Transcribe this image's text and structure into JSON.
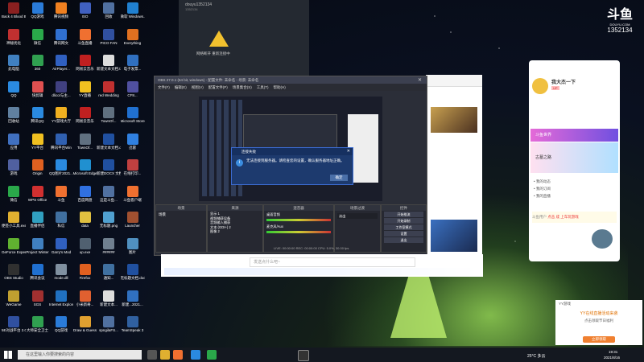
{
  "desktop_icons": [
    {
      "label": "Back 4 Blood Beta",
      "color": "#8a2020"
    },
    {
      "label": "QQ游戏",
      "color": "#2a7bd8"
    },
    {
      "label": "腾讯视频",
      "color": "#f08020"
    },
    {
      "label": "ISO",
      "color": "#4060c0"
    },
    {
      "label": "回收",
      "color": "#5070a0"
    },
    {
      "label": "微软 Windows...",
      "color": "#2080d0"
    },
    {
      "label": "神秘优化",
      "color": "#c03030"
    },
    {
      "label": "微信",
      "color": "#2aa84a"
    },
    {
      "label": "腾讯网文",
      "color": "#3070d0"
    },
    {
      "label": "斗鱼直播",
      "color": "#f07030"
    },
    {
      "label": "PICO FAN",
      "color": "#3050a0"
    },
    {
      "label": "Everything",
      "color": "#e07020"
    },
    {
      "label": "此电脑",
      "color": "#4080c0"
    },
    {
      "label": "360",
      "color": "#30a050"
    },
    {
      "label": "AirPlayer...",
      "color": "#3060c0"
    },
    {
      "label": "网易云音乐",
      "color": "#c02020"
    },
    {
      "label": "新建文本文档.txt",
      "color": "#dddddd"
    },
    {
      "label": "电子发票...",
      "color": "#3070c0"
    },
    {
      "label": "QQ",
      "color": "#2a8ae0"
    },
    {
      "label": "快剪辑",
      "color": "#e05050"
    },
    {
      "label": "dlico/与主...",
      "color": "#404080"
    },
    {
      "label": "YY直播",
      "color": "#f0c020"
    },
    {
      "label": "red Wedding",
      "color": "#c03030"
    },
    {
      "label": "CF8...",
      "color": "#5050a0"
    },
    {
      "label": "回收站",
      "color": "#6080a0"
    },
    {
      "label": "腾讯QQ",
      "color": "#2a8ae0"
    },
    {
      "label": "YY游戏大厅",
      "color": "#f0b020"
    },
    {
      "label": "网易云音乐",
      "color": "#c02020"
    },
    {
      "label": "TownOf...",
      "color": "#607080"
    },
    {
      "label": "Microsoft Store",
      "color": "#2070d0"
    },
    {
      "label": "应用",
      "color": "#4070c0"
    },
    {
      "label": "YY平台",
      "color": "#f0c020"
    },
    {
      "label": "腾讯平台Win",
      "color": "#3060b0"
    },
    {
      "label": "TownOf...",
      "color": "#607080"
    },
    {
      "label": "新建文本文档.docx",
      "color": "#2050a0"
    },
    {
      "label": "迅雷",
      "color": "#3080e0"
    },
    {
      "label": "游戏",
      "color": "#5060a0"
    },
    {
      "label": "Origin",
      "color": "#e06020"
    },
    {
      "label": "QQ图片2021...",
      "color": "#2a8ae0"
    },
    {
      "label": "Microsoft Edge",
      "color": "#2090d0"
    },
    {
      "label": "新建DOCX 文档.docx",
      "color": "#2050a0"
    },
    {
      "label": "在线打印...",
      "color": "#c04040"
    },
    {
      "label": "微信",
      "color": "#2aa84a"
    },
    {
      "label": "WPS Office",
      "color": "#d03030"
    },
    {
      "label": "斗鱼",
      "color": "#f07030"
    },
    {
      "label": "百度网盘",
      "color": "#3070e0"
    },
    {
      "label": "这是斗鱼...",
      "color": "#5070a0"
    },
    {
      "label": "斗鱼客户端",
      "color": "#f07030"
    },
    {
      "label": "便签小工具.exe",
      "color": "#e0b030"
    },
    {
      "label": "直播伴侣",
      "color": "#30a0c0"
    },
    {
      "label": "私信",
      "color": "#4070a0"
    },
    {
      "label": "data",
      "color": "#e0c040"
    },
    {
      "label": "无标题.png",
      "color": "#50a0d0"
    },
    {
      "label": "Launcher",
      "color": "#a05030"
    },
    {
      "label": "GeForce Experience",
      "color": "#60b030"
    },
    {
      "label": "Project Winter",
      "color": "#4080c0"
    },
    {
      "label": "Garry's Mod",
      "color": "#3060c0"
    },
    {
      "label": "up.exe",
      "color": "#506070"
    },
    {
      "label": "######",
      "color": "#708090"
    },
    {
      "label": "图片",
      "color": "#5090c0"
    },
    {
      "label": "OBS Studio",
      "color": "#303030"
    },
    {
      "label": "腾讯会议",
      "color": "#2070d0"
    },
    {
      "label": "mode.dll",
      "color": "#8090a0"
    },
    {
      "label": "Firefox",
      "color": "#e06020"
    },
    {
      "label": "通知...",
      "color": "#4070a0"
    },
    {
      "label": "无标题文档.docx",
      "color": "#2050a0"
    },
    {
      "label": "WeGame",
      "color": "#c0a030"
    },
    {
      "label": "SGS",
      "color": "#a03030"
    },
    {
      "label": "Internet Explorer",
      "color": "#2070c0"
    },
    {
      "label": "小米新奇...",
      "color": "#e06030"
    },
    {
      "label": "新建文本...",
      "color": "#dddddd"
    },
    {
      "label": "新建...2021...",
      "color": "#3070c0"
    },
    {
      "label": "5E对战平台 2.0",
      "color": "#3050a0"
    },
    {
      "label": "大师安全卫士",
      "color": "#30a050"
    },
    {
      "label": "QQ游戏",
      "color": "#2a7bd8"
    },
    {
      "label": "Draw & Guess",
      "color": "#e0a030"
    },
    {
      "label": "spngilaFS...",
      "color": "#5070a0"
    },
    {
      "label": "TeamSpeak 3",
      "color": "#3060a0"
    }
  ],
  "top_dialog": {
    "title": "douyu1352134",
    "subtitle": "1352134",
    "warning": "网络断开 重新连接中"
  },
  "obs": {
    "title": "OBS 27.0.1 (64 bit, windows) - 配置文件: 未命名 - 场景: 未命名",
    "menu": [
      "文件(F)",
      "编辑(E)",
      "视图(V)",
      "配置文件(P)",
      "场景集合(S)",
      "工具(T)",
      "帮助(H)"
    ],
    "dock_labels": [
      "场景",
      "来源",
      "混音器",
      "场景过渡",
      "控件"
    ],
    "scene_item": "场景",
    "sources": [
      "显示 1",
      "视频捕获设备",
      "音频输入捕获",
      "文本 (GDI+) 2",
      "图像 2"
    ],
    "mixer": [
      "桌面音频",
      "麦克风/Aux"
    ],
    "transition": "淡出",
    "controls": [
      "开始推流",
      "开始录制",
      "工作室模式",
      "设置",
      "退出"
    ],
    "status": "LIVE: 00:00:00   REC: 00:00:00   CPU: 5.0%, 30.00 fps"
  },
  "error_dialog": {
    "title": "连接失败",
    "message": "无法连接到服务器。请检查您的设置，确认服务器地址正确。",
    "ok": "确定"
  },
  "chatbar": {
    "placeholder": "发送点什么吧~",
    "labels": [
      "原神",
      "弹幕",
      "设置"
    ]
  },
  "right_panel": {
    "username": "我大杰一下",
    "level": "UP",
    "menu_items": [
      "我的动态",
      "我的订阅",
      "我的直播"
    ],
    "banner1": "斗鱼世界",
    "banner2": "古墓之路",
    "chat_user": "斗鱼用户",
    "chat_msg": "点击 成 上车玩游戏"
  },
  "logo": {
    "text": "斗鱼",
    "sub": "DOUYU.COM",
    "room": "1352134"
  },
  "notification": {
    "title": "YY游戏",
    "body": "YY在线直播活动来袭",
    "line2": "点击领取节日福利",
    "button": "立即领取"
  },
  "taskbar": {
    "search_placeholder": "在这里输入你要搜索的内容",
    "weather": "25°C 多云",
    "time": "19:31",
    "date": "2021/8/16"
  }
}
